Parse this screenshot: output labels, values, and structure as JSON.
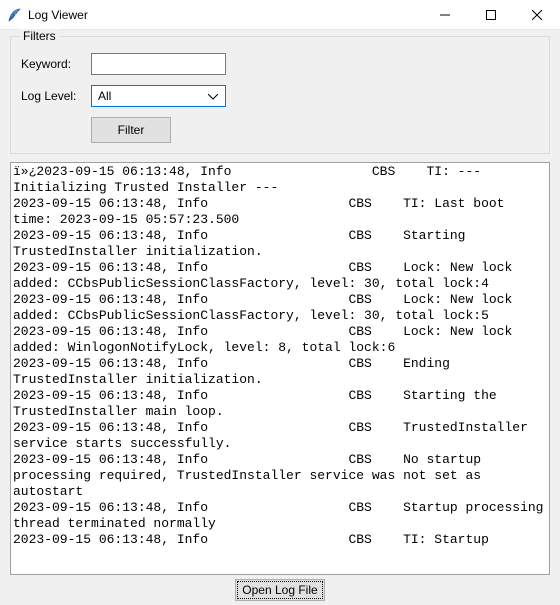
{
  "window": {
    "title": "Log Viewer"
  },
  "filters": {
    "group_label": "Filters",
    "keyword_label": "Keyword:",
    "keyword_value": "",
    "loglevel_label": "Log Level:",
    "loglevel_selected": "All",
    "filter_button": "Filter"
  },
  "bottom": {
    "open_button": "Open Log File"
  },
  "log_lines": [
    "ï»¿2023-09-15 06:13:48, Info                  CBS    TI: --- Initializing Trusted Installer ---",
    "2023-09-15 06:13:48, Info                  CBS    TI: Last boot time: 2023-09-15 05:57:23.500",
    "2023-09-15 06:13:48, Info                  CBS    Starting TrustedInstaller initialization.",
    "2023-09-15 06:13:48, Info                  CBS    Lock: New lock added: CCbsPublicSessionClassFactory, level: 30, total lock:4",
    "2023-09-15 06:13:48, Info                  CBS    Lock: New lock added: CCbsPublicSessionClassFactory, level: 30, total lock:5",
    "2023-09-15 06:13:48, Info                  CBS    Lock: New lock added: WinlogonNotifyLock, level: 8, total lock:6",
    "2023-09-15 06:13:48, Info                  CBS    Ending TrustedInstaller initialization.",
    "2023-09-15 06:13:48, Info                  CBS    Starting the TrustedInstaller main loop.",
    "2023-09-15 06:13:48, Info                  CBS    TrustedInstaller service starts successfully.",
    "2023-09-15 06:13:48, Info                  CBS    No startup processing required, TrustedInstaller service was not set as autostart",
    "2023-09-15 06:13:48, Info                  CBS    Startup processing thread terminated normally",
    "2023-09-15 06:13:48, Info                  CBS    TI: Startup"
  ]
}
